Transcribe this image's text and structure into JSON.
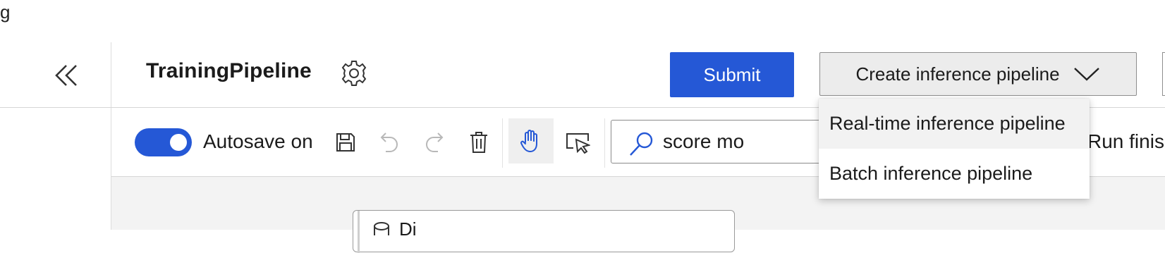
{
  "fragment_text": "g",
  "header": {
    "title": "TrainingPipeline",
    "submit_label": "Submit",
    "create_inference_label": "Create inference pipeline"
  },
  "toolbar": {
    "autosave_label": "Autosave on",
    "autosave_on": true,
    "search_value": "score mo",
    "run_status": "Run finish"
  },
  "dropdown": {
    "items": [
      {
        "label": "Real-time inference pipeline",
        "hovered": true
      },
      {
        "label": "Batch inference pipeline",
        "hovered": false
      }
    ]
  },
  "canvas": {
    "node_label": "Di"
  },
  "icons": {
    "collapse": "double-chevron-left-icon",
    "settings": "gear-icon",
    "dropdown": "chevron-down-icon",
    "save": "save-icon",
    "undo": "undo-icon",
    "redo": "redo-icon",
    "delete": "trash-icon",
    "pan": "hand-icon",
    "select": "pointer-select-icon",
    "search": "search-icon",
    "dataset": "database-icon"
  },
  "colors": {
    "accent": "#2558d6",
    "submit_text": "#ffffff",
    "create_bg": "#ececec",
    "canvas_bg": "#f3f3f3"
  }
}
